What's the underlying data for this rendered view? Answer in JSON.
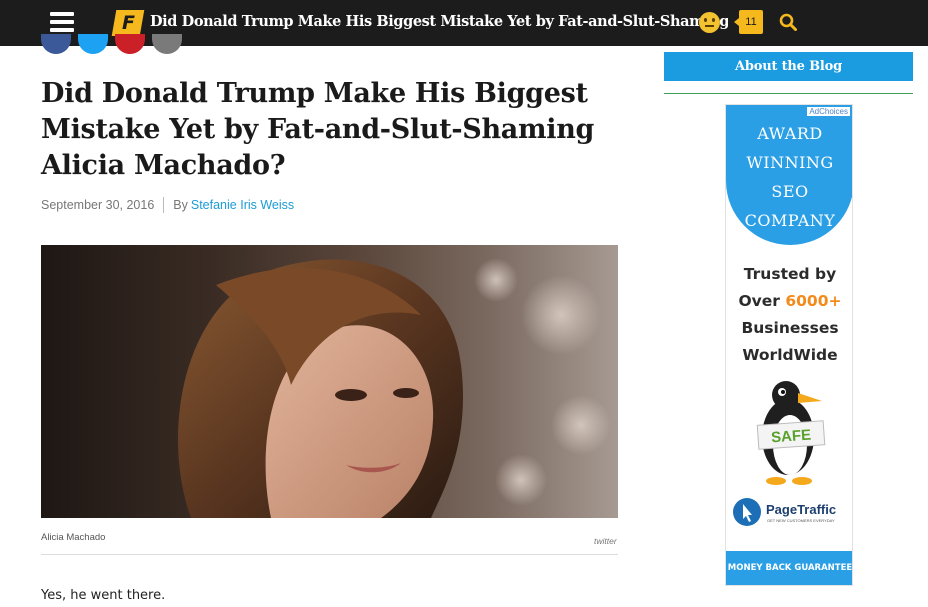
{
  "header": {
    "logo_letter": "F",
    "title": "Did Donald Trump Make His Biggest Mistake Yet by Fat-and-Slut-Shaming Alicia Machado?",
    "comment_count": "11"
  },
  "share": [
    "facebook-icon",
    "twitter-icon",
    "pinterest-icon",
    "email-icon"
  ],
  "article": {
    "headline": "Did Donald Trump Make His Biggest Mistake Yet by Fat-and-Slut-Shaming Alicia Machado?",
    "date": "September 30, 2016",
    "by_label": "By",
    "author": "Stefanie Iris Weiss",
    "image_caption": "Alicia Machado",
    "image_credit": "twitter",
    "first_paragraph": "Yes, he went there."
  },
  "sidebar": {
    "about_label": "About the Blog",
    "ad": {
      "adchoices": "AdChoices",
      "headline": [
        "AWARD",
        "WINNING",
        "SEO",
        "COMPANY"
      ],
      "trusted_1": "Trusted by",
      "trusted_2_prefix": "Over ",
      "trusted_2_highlight": "6000+",
      "trusted_3": "Businesses",
      "trusted_4": "WorldWide",
      "badge": "SAFE",
      "brand": "PageTraffic",
      "brand_tagline": "GET NEW CUSTOMERS EVERYDAY",
      "bottom": "MONEY BACK GUARANTEE"
    }
  },
  "colors": {
    "topbar": "#1c1c1c",
    "brand_yellow": "#f5b91e",
    "link_blue": "#1b9bd7",
    "about_button": "#1b9be0",
    "ad_blue": "#2b9fe6",
    "ad_orange": "#f48a1b"
  }
}
